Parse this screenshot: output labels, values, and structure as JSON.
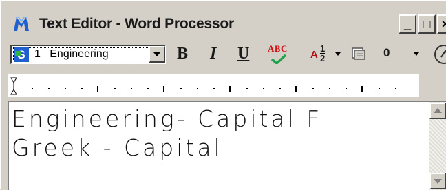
{
  "window": {
    "title": "Text Editor - Word Processor",
    "icon": "microstation-logo-icon",
    "controls": {
      "minimize": "_",
      "maximize": "□",
      "close": "×"
    }
  },
  "toolbar": {
    "font": {
      "number": "1",
      "name": "Engineering"
    },
    "bold_label": "B",
    "italic_label": "I",
    "underline_label": "U",
    "spell_label": "ABC",
    "fraction": {
      "letter": "A",
      "numerator": "1",
      "denominator": "2"
    },
    "line_spacing_value": "0"
  },
  "editor": {
    "lines": [
      "Engineering- Capital F",
      "Greek - Capital"
    ]
  },
  "colors": {
    "face": "#d4d0c8",
    "spell_red": "#d01010",
    "spell_check": "#1fa34a",
    "font_icon_blue": "#1f5fcf"
  }
}
